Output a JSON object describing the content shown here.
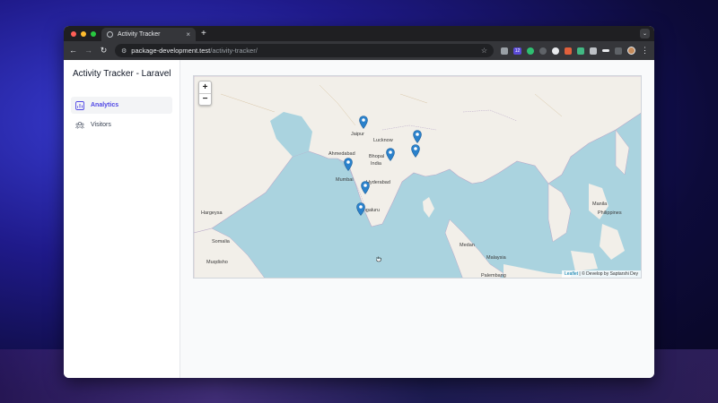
{
  "browser": {
    "tab_title": "Activity Tracker",
    "tab_close": "×",
    "new_tab": "+",
    "tab_menu": "⌄",
    "url_host": "package-development.test",
    "url_path": "/activity-tracker/",
    "ext_badge": "12"
  },
  "sidebar": {
    "app_title": "Activity Tracker - Laravel",
    "items": [
      {
        "label": "Analytics",
        "icon": "chart-icon",
        "active": true
      },
      {
        "label": "Visitors",
        "icon": "users-icon",
        "active": false
      }
    ]
  },
  "map": {
    "zoom_in": "+",
    "zoom_out": "−",
    "attribution_leaflet": "Leaflet",
    "attribution_rest": "| © Develop by Saptarshi Dey",
    "labels": [
      "Jaipur",
      "Lucknow",
      "Ahmedabad",
      "Bhopal",
      "India",
      "Mumbai",
      "Hyderabad",
      "Bengaluru",
      "Hargeysa",
      "Somalia",
      "Muqdisho",
      "Medan",
      "Palembang",
      "Malaysia",
      "Philippines",
      "Manila"
    ],
    "marker_count": 8,
    "marker_color": "#2a81cb"
  }
}
